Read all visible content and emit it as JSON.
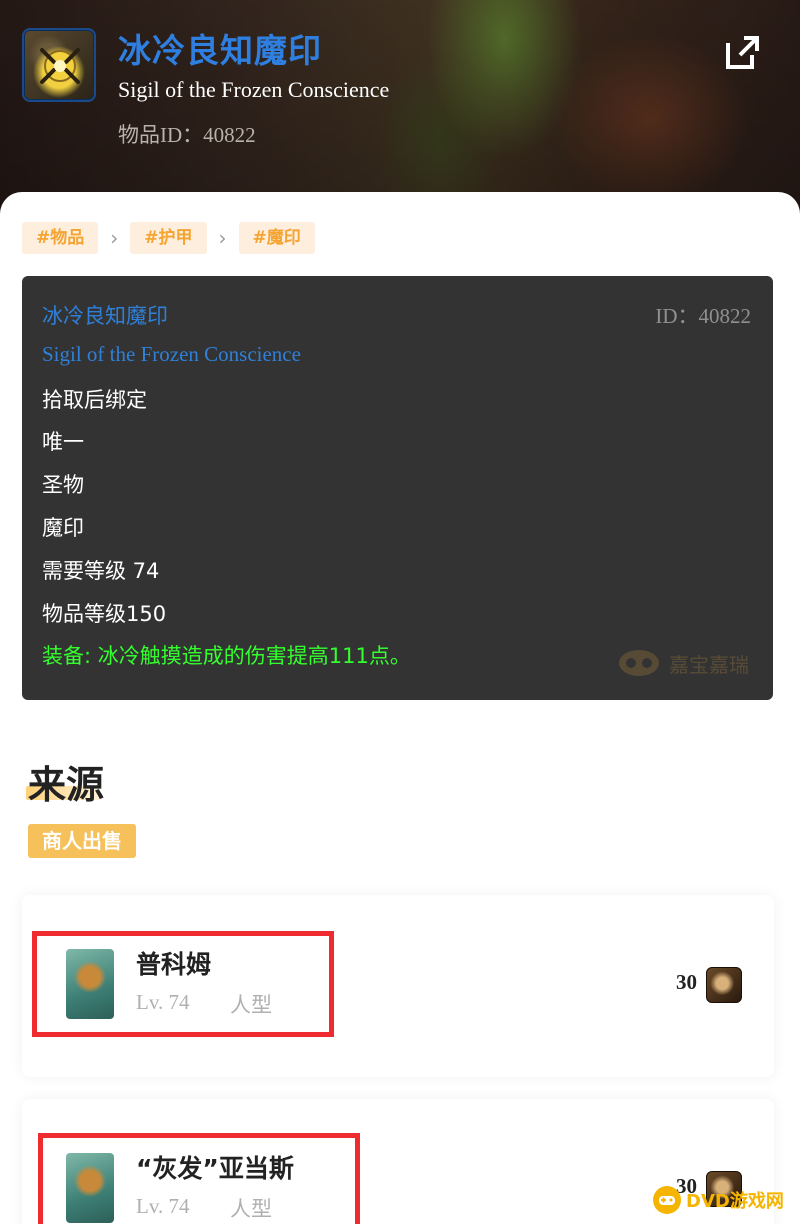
{
  "header": {
    "title_cn": "冰冷良知魔印",
    "title_en": "Sigil of the Frozen Conscience",
    "item_id_label": "物品ID：40822",
    "icon": "sigil-icon"
  },
  "tags": [
    "#物品",
    "#护甲",
    "#魔印"
  ],
  "tooltip": {
    "name_cn": "冰冷良知魔印",
    "name_en": "Sigil of the Frozen Conscience",
    "id": "ID：40822",
    "lines": [
      "拾取后绑定",
      "唯一",
      "圣物",
      "魔印",
      "需要等级 74",
      "物品等级150"
    ],
    "equip_effect": "装备: 冰冷触摸造成的伤害提高111点。",
    "watermark": "嘉宝嘉瑞"
  },
  "source": {
    "title": "来源",
    "badge": "商人出售"
  },
  "npcs": [
    {
      "name": "普科姆",
      "level": "Lv. 74",
      "type": "人型",
      "price": "30"
    },
    {
      "name": "“灰发”亚当斯",
      "level": "Lv. 74",
      "type": "人型",
      "price": "30"
    }
  ],
  "site_logo": "DVD游戏网",
  "colors": {
    "title_blue": "#2e7fe0",
    "tag_orange": "#f5a431",
    "equip_green": "#34ff2e",
    "badge_yellow": "#f6c05a",
    "highlight_red": "#ee2b2f"
  }
}
